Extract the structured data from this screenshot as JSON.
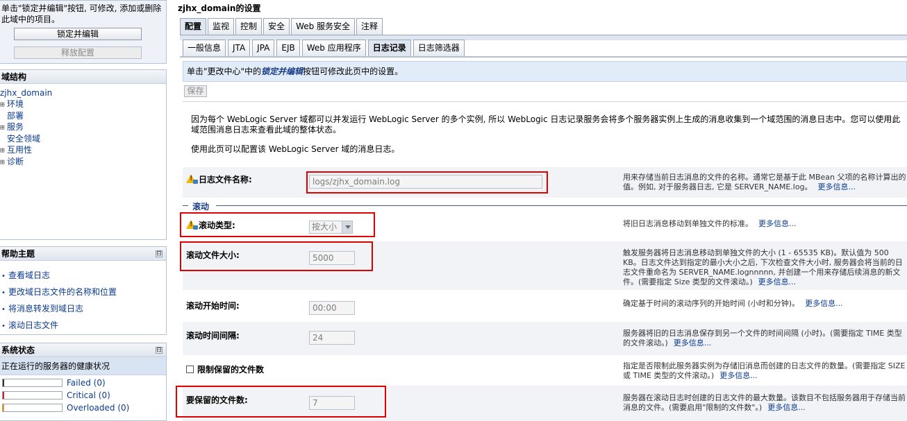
{
  "change_center": {
    "message": "单击\"锁定并编辑\"按钮, 可修改, 添加或删除此域中的项目。",
    "lock_edit_label": "锁定并编辑",
    "release_label": "释放配置"
  },
  "domain_structure": {
    "title": "域结构",
    "root": "zjhx_domain",
    "items": [
      {
        "prefix": "⊞",
        "label": "环境"
      },
      {
        "prefix": "",
        "label": "部署"
      },
      {
        "prefix": "⊞",
        "label": "服务"
      },
      {
        "prefix": "",
        "label": "安全领域"
      },
      {
        "prefix": "⊞",
        "label": "互用性"
      },
      {
        "prefix": "⊞",
        "label": "诊断"
      }
    ]
  },
  "help_topics": {
    "title": "帮助主题",
    "collapse_symbol": "⊟",
    "bullet_symbol": "•",
    "items": [
      "查看域日志",
      "更改域日志文件的名称和位置",
      "将消息转发到域日志",
      "滚动日志文件"
    ]
  },
  "system_status": {
    "title": "系统状态",
    "collapse_symbol": "⊟",
    "subtitle": "正在运行的服务器的健康状况",
    "rows": [
      {
        "label": "Failed (0)",
        "color": "#333333"
      },
      {
        "label": "Critical (0)",
        "color": "#d02020"
      },
      {
        "label": "Overloaded (0)",
        "color": "#e0a000"
      }
    ]
  },
  "page": {
    "title": "zjhx_domain的设置",
    "tabs": [
      "配置",
      "监视",
      "控制",
      "安全",
      "Web 服务安全",
      "注释"
    ],
    "active_tab": 0,
    "subtabs": [
      "一般信息",
      "JTA",
      "JPA",
      "EJB",
      "Web 应用程序",
      "日志记录",
      "日志筛选器"
    ],
    "active_subtab": 5,
    "notice_prefix": "单击\"更改中心\"中的",
    "notice_em": "锁定并编辑",
    "notice_suffix": "按钮可修改此页中的设置。",
    "save_label": "保存",
    "description": "因为每个 WebLogic Server 域都可以并发运行 WebLogic Server 的多个实例, 所以 WebLogic 日志记录服务会将多个服务器实例上生成的消息收集到一个域范围的消息日志中。您可以使用此域范围消息日志来查看此域的整体状态。",
    "description2": "使用此页可以配置该 WebLogic Server 域的消息日志。",
    "more_info": "更多信息...",
    "rotation_section": "滚动"
  },
  "fields": {
    "log_file_name": {
      "label": "日志文件名称:",
      "value": "logs/zjhx_domain.log",
      "help": "用来存储当前日志消息的文件的名称。通常它是基于此 MBean 父项的名称计算出的值。例如, 对于服务器日志, 它是 SERVER_NAME.log。"
    },
    "rotation_type": {
      "label": "滚动类型:",
      "value": "按大小",
      "help": "将旧日志消息移动到单独文件的标准。"
    },
    "rotation_file_size": {
      "label": "滚动文件大小:",
      "value": "5000",
      "help": "触发服务器将日志消息移动到单独文件的大小 (1 - 65535 KB)。默认值为 500 KB。日志文件达到指定的最小大小之后, 下次检查文件大小时, 服务器会将当前的日志文件重命名为 SERVER_NAME.lognnnnn, 并创建一个用来存储后续消息的新文件。(需要指定 Size 类型的文件滚动。)"
    },
    "rotation_start_time": {
      "label": "滚动开始时间:",
      "value": "00:00",
      "help": "确定基于时间的滚动序列的开始时间 (小时和分钟)。"
    },
    "rotation_interval": {
      "label": "滚动时间间隔:",
      "value": "24",
      "help": "服务器将旧的日志消息保存到另一个文件的时间间隔 (小时)。(需要指定 TIME 类型的文件滚动。)"
    },
    "limit_retained": {
      "label": "限制保留的文件数",
      "help": "指定是否限制此服务器实例为存储旧消息而创建的日志文件的数量。(需要指定 SIZE 或 TIME 类型的文件滚动。)"
    },
    "files_to_retain": {
      "label": "要保留的文件数:",
      "value": "7",
      "help": "服务器在滚动日志时创建的日志文件的最大数量。该数目不包括服务器用于存储当前消息的文件。(需要启用\"限制的文件数\"。)"
    }
  },
  "highlight_color": "#e00000"
}
